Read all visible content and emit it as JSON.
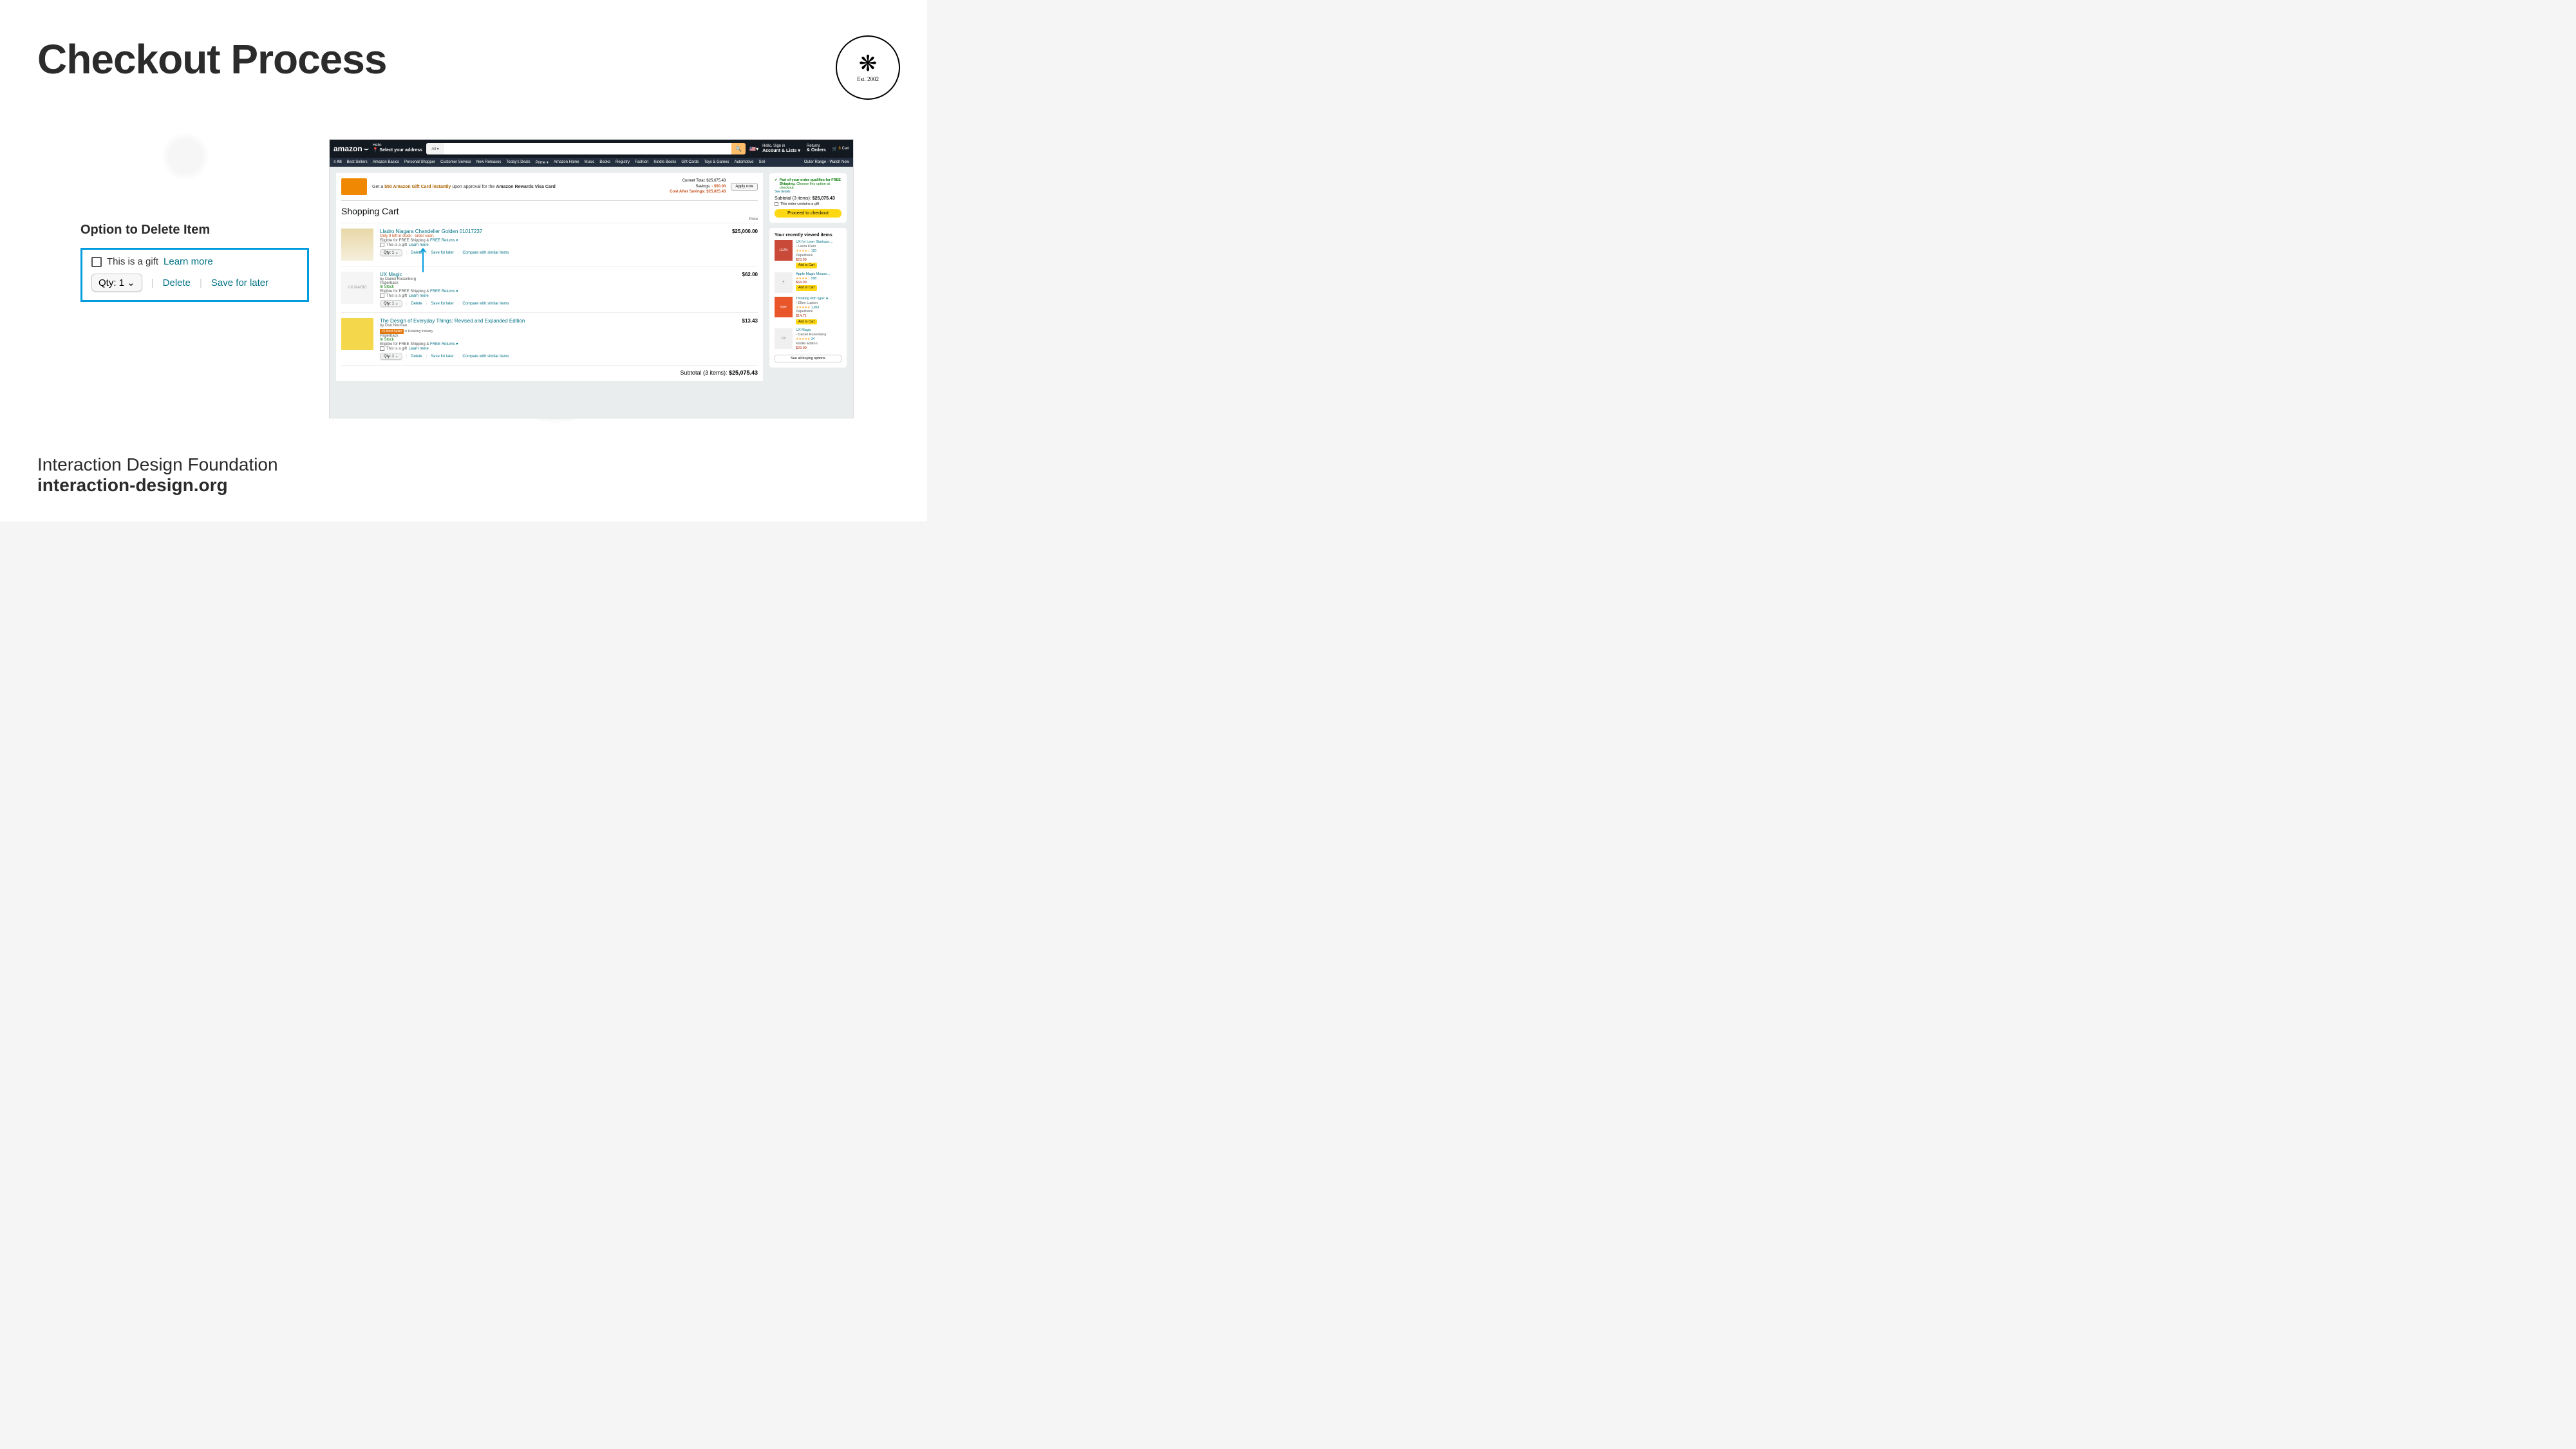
{
  "slide": {
    "title": "Checkout Process",
    "logo_est": "Est. 2002",
    "callout_title": "Option to Delete Item",
    "footer_line1": "Interaction Design Foundation",
    "footer_line2": "interaction-design.org"
  },
  "callout": {
    "gift_text": "This is a gift",
    "learn_more": "Learn more",
    "qty": "Qty: 1 ⌄",
    "delete": "Delete",
    "save": "Save for later"
  },
  "amazon": {
    "logo": "amazon",
    "address_hello": "Hello",
    "address_select": "Select your address",
    "search_cat": "All ▾",
    "signin_hello": "Hello, Sign in",
    "signin_account": "Account & Lists ▾",
    "returns": "Returns",
    "orders": "& Orders",
    "cart_count": "3",
    "cart_label": "Cart",
    "nav": [
      "≡ All",
      "Best Sellers",
      "Amazon Basics",
      "Personal Shopper",
      "Customer Service",
      "New Releases",
      "Today's Deals",
      "Prime ▾",
      "Amazon Home",
      "Music",
      "Books",
      "Registry",
      "Fashion",
      "Kindle Books",
      "Gift Cards",
      "Toys & Games",
      "Automotive",
      "Sell"
    ],
    "nav_promo": "Outer Range - Watch Now",
    "banner": {
      "pre": "Get a ",
      "amount": "$50 Amazon Gift Card instantly",
      "mid": " upon approval for the ",
      "card": "Amazon Rewards Visa Card",
      "apply": "Apply now",
      "current_total_label": "Current Total:",
      "current_total": "$25,075.43",
      "savings_label": "Savings:",
      "savings": "- $50.00",
      "after_label": "Cost After Savings:",
      "after": "$25,025.43"
    },
    "cart_heading": "Shopping Cart",
    "price_label": "Price",
    "gift_text": "This is a gift",
    "learn_more": "Learn more",
    "qty_label": "Qty: 1 ⌄",
    "delete": "Delete",
    "save": "Save for later",
    "compare": "Compare with similar items",
    "eligible": "Eligible for FREE Shipping & ",
    "free_returns": "FREE Returns ▾",
    "items": [
      {
        "name": "Lladro Niagara Chandelier Golden 01017237",
        "stock": "Only 9 left in stock - order soon.",
        "stock_class": "stock-red",
        "price": "$25,000.00",
        "author": "",
        "format": "",
        "badge": ""
      },
      {
        "name": "UX Magic",
        "author": "by Daniel Rosenberg",
        "format": "Paperback",
        "stock": "In Stock",
        "stock_class": "stock-green",
        "price": "$62.00",
        "badge": ""
      },
      {
        "name": "The Design of Everyday Things: Revised and Expanded Edition",
        "author": "by Don Norman",
        "format": "Paperback",
        "stock": "In Stock",
        "stock_class": "stock-green",
        "price": "$13.43",
        "badge": "#1 Best Seller",
        "badge_txt": " in Retailing Industry"
      }
    ],
    "subtotal_label": "Subtotal (3 items): ",
    "subtotal_value": "$25,075.43",
    "sidebox": {
      "free_ship": "Part of your order qualifies for FREE Shipping.",
      "choose": " Choose this option at checkout.",
      "details": "See details",
      "subtotal": "Subtotal (3 items): ",
      "subtotal_val": "$25,075.43",
      "gift": "This order contains a gift",
      "proceed": "Proceed to checkout"
    },
    "recent": {
      "heading": "Your recently viewed items",
      "items": [
        {
          "name": "UX for Lean Startups:…",
          "author": "› Laura Klein",
          "stars": "★★★★☆",
          "count": "120",
          "format": "Paperback",
          "price": "$23.99",
          "cta": "Add to Cart"
        },
        {
          "name": "Apple Magic Mouse…",
          "author": "",
          "stars": "★★★★☆",
          "count": "598",
          "format": "",
          "price": "$64.99",
          "cta": "Add to Cart"
        },
        {
          "name": "Thinking with type: A…",
          "author": "› Ellen Lupton",
          "stars": "★★★★★",
          "count": "1,863",
          "format": "Paperback",
          "price": "$14.71",
          "cta": "Add to Cart"
        },
        {
          "name": "UX Magic",
          "author": "› Daniel Rosenberg",
          "stars": "★★★★★",
          "count": "34",
          "format": "Kindle Edition",
          "price": "$29.00",
          "cta": ""
        }
      ],
      "see_all": "See all buying options"
    }
  }
}
